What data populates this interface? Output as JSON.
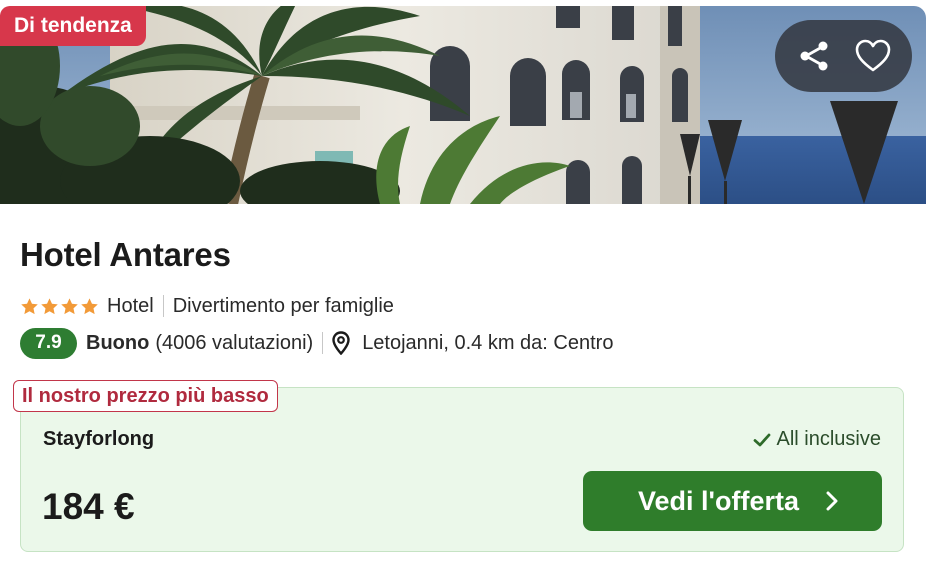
{
  "badge": {
    "label": "Di tendenza"
  },
  "actions": {
    "share_icon": "share-icon",
    "favorite_icon": "heart-icon"
  },
  "hotel": {
    "name": "Hotel Antares",
    "stars": 4,
    "type": "Hotel",
    "category": "Divertimento per famiglie",
    "rating_score": "7.9",
    "rating_label": "Buono",
    "reviews": "(4006 valutazioni)",
    "location": "Letojanni, 0.4 km da: Centro"
  },
  "offer": {
    "tag": "Il nostro prezzo più basso",
    "provider": "Stayforlong",
    "board": "All inclusive",
    "price": "184 €",
    "cta_label": "Vedi l'offerta"
  },
  "colors": {
    "badge": "#d7374b",
    "rating": "#2e7d32",
    "star": "#f29a38",
    "offer_bg": "#ebf8ea",
    "cta": "#2f7d2b",
    "tag_border": "#c2364a"
  }
}
